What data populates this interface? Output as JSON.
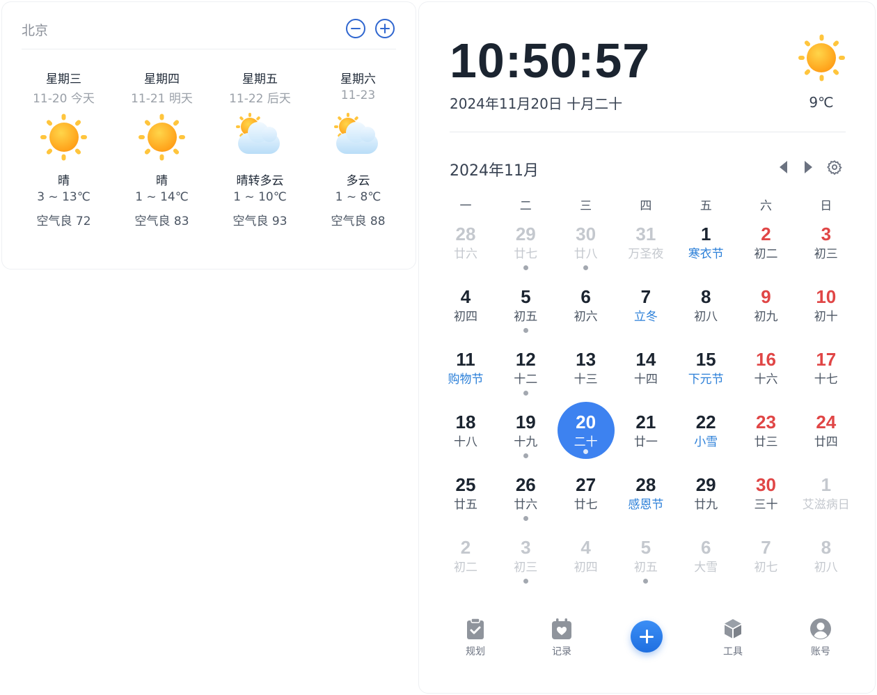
{
  "colors": {
    "accent": "#3d82f0",
    "weekend": "#e04646",
    "festival": "#2b7fd8",
    "muted": "#c4c8ce"
  },
  "weather": {
    "city": "北京",
    "days": [
      {
        "week": "星期三",
        "date": "11-20 今天",
        "icon": "sun-icon",
        "condition": "晴",
        "temp": "3 ~ 13℃",
        "aqi": "空气良 72"
      },
      {
        "week": "星期四",
        "date": "11-21 明天",
        "icon": "sun-icon",
        "condition": "晴",
        "temp": "1 ~ 14℃",
        "aqi": "空气良 83"
      },
      {
        "week": "星期五",
        "date": "11-22 后天",
        "icon": "partly-cloudy-icon",
        "condition": "晴转多云",
        "temp": "1 ~ 10℃",
        "aqi": "空气良 93"
      },
      {
        "week": "星期六",
        "date": "11-23",
        "icon": "partly-cloudy-icon",
        "condition": "多云",
        "temp": "1 ~ 8℃",
        "aqi": "空气良 88"
      }
    ]
  },
  "clock": {
    "time": "10:50:57",
    "date": "2024年11月20日 十月二十",
    "temp": "9℃",
    "icon": "sun-icon"
  },
  "calendar": {
    "month_title": "2024年11月",
    "weekdays": [
      "一",
      "二",
      "三",
      "四",
      "五",
      "六",
      "日"
    ],
    "cells": [
      {
        "day": "28",
        "lunar": "廿六",
        "other": true
      },
      {
        "day": "29",
        "lunar": "廿七",
        "other": true,
        "dot": true
      },
      {
        "day": "30",
        "lunar": "廿八",
        "other": true,
        "dot": true
      },
      {
        "day": "31",
        "lunar": "万圣夜",
        "other": true
      },
      {
        "day": "1",
        "lunar": "寒衣节",
        "festival": true
      },
      {
        "day": "2",
        "lunar": "初二",
        "weekend": true
      },
      {
        "day": "3",
        "lunar": "初三",
        "weekend": true
      },
      {
        "day": "4",
        "lunar": "初四"
      },
      {
        "day": "5",
        "lunar": "初五",
        "dot": true
      },
      {
        "day": "6",
        "lunar": "初六"
      },
      {
        "day": "7",
        "lunar": "立冬",
        "festival": true
      },
      {
        "day": "8",
        "lunar": "初八"
      },
      {
        "day": "9",
        "lunar": "初九",
        "weekend": true
      },
      {
        "day": "10",
        "lunar": "初十",
        "weekend": true
      },
      {
        "day": "11",
        "lunar": "购物节",
        "festival": true
      },
      {
        "day": "12",
        "lunar": "十二",
        "dot": true
      },
      {
        "day": "13",
        "lunar": "十三"
      },
      {
        "day": "14",
        "lunar": "十四"
      },
      {
        "day": "15",
        "lunar": "下元节",
        "festival": true
      },
      {
        "day": "16",
        "lunar": "十六",
        "weekend": true
      },
      {
        "day": "17",
        "lunar": "十七",
        "weekend": true
      },
      {
        "day": "18",
        "lunar": "十八"
      },
      {
        "day": "19",
        "lunar": "十九",
        "dot": true
      },
      {
        "day": "20",
        "lunar": "二十",
        "today": true,
        "dot": true
      },
      {
        "day": "21",
        "lunar": "廿一"
      },
      {
        "day": "22",
        "lunar": "小雪",
        "festival": true
      },
      {
        "day": "23",
        "lunar": "廿三",
        "weekend": true
      },
      {
        "day": "24",
        "lunar": "廿四",
        "weekend": true
      },
      {
        "day": "25",
        "lunar": "廿五"
      },
      {
        "day": "26",
        "lunar": "廿六",
        "dot": true
      },
      {
        "day": "27",
        "lunar": "廿七"
      },
      {
        "day": "28",
        "lunar": "感恩节",
        "festival": true
      },
      {
        "day": "29",
        "lunar": "廿九"
      },
      {
        "day": "30",
        "lunar": "三十",
        "weekend": true
      },
      {
        "day": "1",
        "lunar": "艾滋病日",
        "other": true
      },
      {
        "day": "2",
        "lunar": "初二",
        "other": true
      },
      {
        "day": "3",
        "lunar": "初三",
        "other": true,
        "dot": true
      },
      {
        "day": "4",
        "lunar": "初四",
        "other": true
      },
      {
        "day": "5",
        "lunar": "初五",
        "other": true,
        "dot": true
      },
      {
        "day": "6",
        "lunar": "大雪",
        "other": true
      },
      {
        "day": "7",
        "lunar": "初七",
        "other": true
      },
      {
        "day": "8",
        "lunar": "初八",
        "other": true
      }
    ]
  },
  "bottom_nav": {
    "plan": {
      "label": "规划",
      "icon": "clipboard-check-icon"
    },
    "record": {
      "label": "记录",
      "icon": "calendar-heart-icon"
    },
    "add": {
      "icon": "plus-icon"
    },
    "tools": {
      "label": "工具",
      "icon": "cube-icon"
    },
    "account": {
      "label": "账号",
      "icon": "user-icon"
    }
  }
}
